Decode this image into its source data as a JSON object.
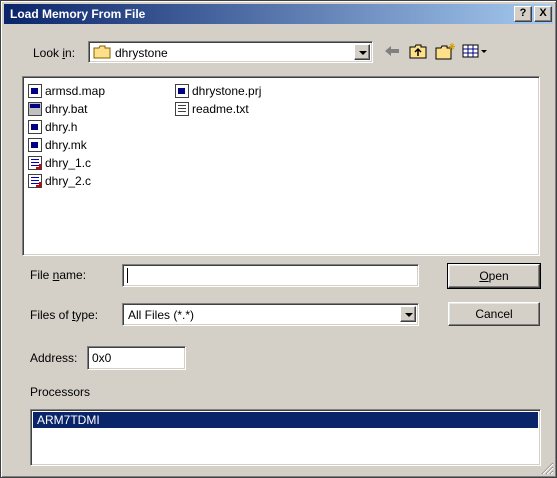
{
  "dialog": {
    "title": "Load Memory From File",
    "help_btn": "?",
    "close_btn": "X"
  },
  "look_in": {
    "label_pre": "Look ",
    "label_key": "i",
    "label_post": "n:",
    "value": "dhrystone"
  },
  "toolbar": {
    "back_icon": "back-arrow-icon",
    "up_icon": "up-folder-icon",
    "new_folder_icon": "new-folder-icon",
    "views_icon": "view-menu-icon"
  },
  "files_col1": [
    {
      "name": "armsd.map",
      "icon": "map"
    },
    {
      "name": "dhry.bat",
      "icon": "bat"
    },
    {
      "name": "dhry.h",
      "icon": "h"
    },
    {
      "name": "dhry.mk",
      "icon": "mk"
    },
    {
      "name": "dhry_1.c",
      "icon": "c"
    },
    {
      "name": "dhry_2.c",
      "icon": "c"
    }
  ],
  "files_col2": [
    {
      "name": "dhrystone.prj",
      "icon": "prj"
    },
    {
      "name": "readme.txt",
      "icon": "txt"
    }
  ],
  "file_name": {
    "label_pre": "File ",
    "label_key": "n",
    "label_post": "ame:",
    "value": ""
  },
  "file_type": {
    "label_pre": "Files of ",
    "label_key": "t",
    "label_post": "ype:",
    "value": "All Files (*.*)"
  },
  "open_btn": {
    "key": "O",
    "rest": "pen"
  },
  "cancel_btn": "Cancel",
  "address": {
    "label": "Address:",
    "value": "0x0"
  },
  "processors": {
    "label": "Processors",
    "items": [
      "ARM7TDMI"
    ],
    "selected": 0
  }
}
